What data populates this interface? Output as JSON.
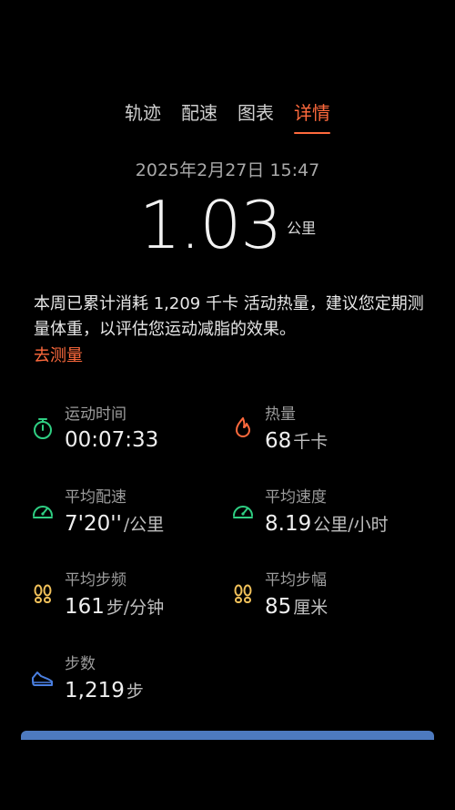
{
  "tabs": [
    {
      "label": "轨迹",
      "active": false
    },
    {
      "label": "配速",
      "active": false
    },
    {
      "label": "图表",
      "active": false
    },
    {
      "label": "详情",
      "active": true
    }
  ],
  "datetime": "2025年2月27日 15:47",
  "distance": {
    "value": "1.03",
    "unit": "公里"
  },
  "note": "本周已累计消耗 1,209 千卡 活动热量，建议您定期测量体重，以评估您运动减脂的效果。",
  "measure_link": "去测量",
  "stats": {
    "time": {
      "label": "运动时间",
      "value": "00:07:33",
      "unit": ""
    },
    "calories": {
      "label": "热量",
      "value": "68",
      "unit": "千卡"
    },
    "avg_pace": {
      "label": "平均配速",
      "value": "7'20''",
      "unit": "/公里"
    },
    "avg_speed": {
      "label": "平均速度",
      "value": "8.19",
      "unit": "公里/小时"
    },
    "cadence": {
      "label": "平均步频",
      "value": "161",
      "unit": "步/分钟"
    },
    "stride": {
      "label": "平均步幅",
      "value": "85",
      "unit": "厘米"
    },
    "steps": {
      "label": "步数",
      "value": "1,219",
      "unit": "步"
    }
  },
  "colors": {
    "accent": "#ff6a3d",
    "green": "#2fcf83",
    "blue": "#4a7fe0",
    "yellow": "#f1c15a"
  }
}
